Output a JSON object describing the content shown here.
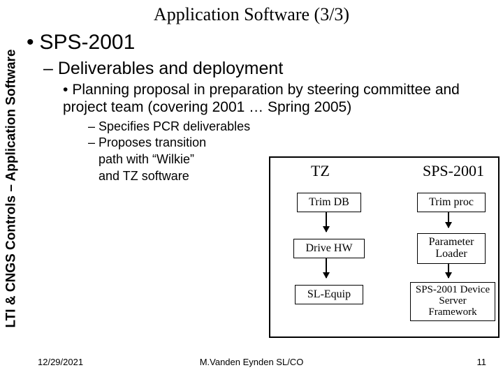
{
  "sideLabel": "LTI & CNGS Controls – Application Software",
  "title": "Application Software (3/3)",
  "bullets": {
    "lvl1": "SPS-2001",
    "lvl2": "– Deliverables and deployment",
    "lvl3": "Planning proposal in preparation by steering committee and project team (covering 2001 … Spring 2005)",
    "lvl4a": "– Specifies PCR deliverables",
    "lvl4b": "– Proposes transition",
    "lvl4c": "   path with “Wilkie”",
    "lvl4d": "   and TZ software"
  },
  "diagram": {
    "headers": {
      "left": "TZ",
      "right": "SPS-2001"
    },
    "left": [
      "Trim DB",
      "Drive HW",
      "SL-Equip"
    ],
    "right": [
      "Trim proc",
      "Parameter Loader",
      "SPS-2001 Device Server Framework"
    ]
  },
  "footer": {
    "date": "12/29/2021",
    "center": "M.Vanden Eynden SL/CO",
    "page": "11"
  }
}
